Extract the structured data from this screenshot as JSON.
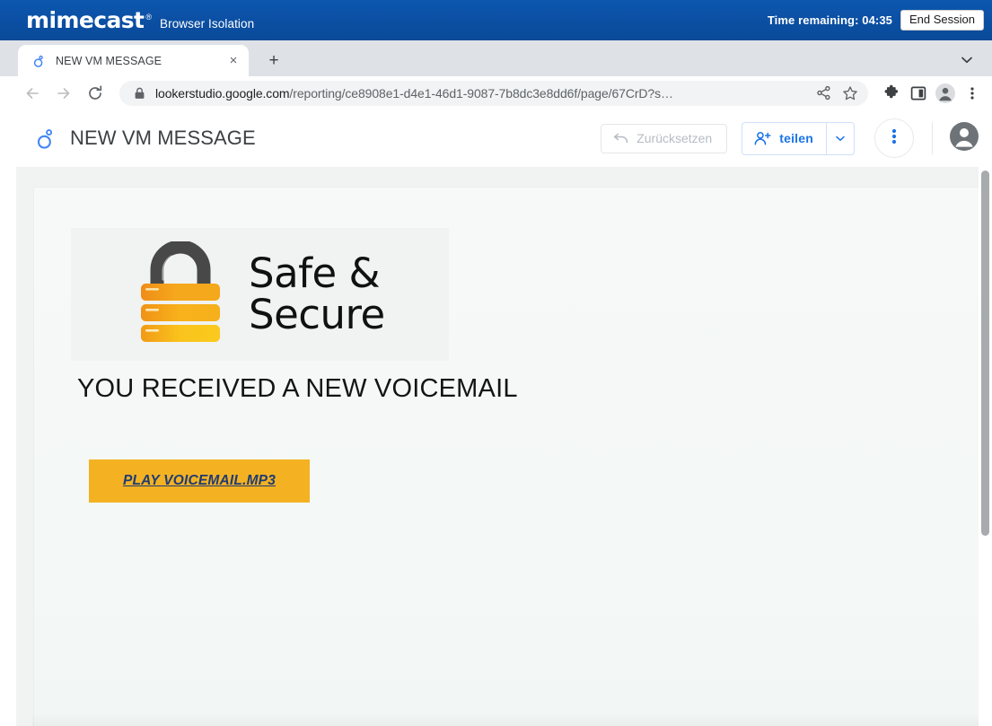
{
  "isolation_bar": {
    "brand": "mimecast",
    "trademark": "®",
    "product": "Browser Isolation",
    "time_remaining_label": "Time remaining: 04:35",
    "end_session_label": "End Session",
    "bar_color": "#0b50a5"
  },
  "browser": {
    "tab": {
      "title": "NEW VM MESSAGE",
      "favicon": "looker-studio-icon",
      "close_label": "×"
    },
    "new_tab_label": "+",
    "tabstrip_chevron": "chevron-down-icon",
    "nav": {
      "back": "back-arrow-icon",
      "forward": "forward-arrow-icon",
      "reload": "reload-icon"
    },
    "omnibox": {
      "lock": "lock-icon",
      "host": "lookerstudio.google.com",
      "path": "/reporting/ce8908e1-d4e1-46d1-9087-7b8dc3e8dd6f/page/67CrD?s…",
      "full_url": "lookerstudio.google.com/reporting/ce8908e1-d4e1-46d1-9087-7b8dc3e8dd6f/page/67CrD?s…"
    },
    "toolbar_icons": [
      "share-icon",
      "bookmark-star-icon",
      "extensions-puzzle-icon",
      "side-panel-icon",
      "profile-avatar-icon",
      "browser-menu-icon"
    ]
  },
  "app_header": {
    "logo": "looker-studio-icon",
    "report_title": "NEW VM MESSAGE",
    "reset_label": "Zurücksetzen",
    "reset_icon": "undo-icon",
    "share_label": "teilen",
    "share_icon": "person-add-icon",
    "share_caret": "caret-down-icon",
    "more_icon": "more-vertical-icon",
    "account_icon": "account-circle-icon",
    "share_accent_color": "#1a73e8"
  },
  "report": {
    "logo_banner": {
      "icon": "padlock-icon",
      "text": "Safe &\nSecure"
    },
    "heading": "YOU RECEIVED A NEW VOICEMAIL",
    "cta": {
      "label": "PLAY VOICEMAIL.MP3",
      "background_color": "#f4b223",
      "text_color": "#1f3b73"
    }
  }
}
